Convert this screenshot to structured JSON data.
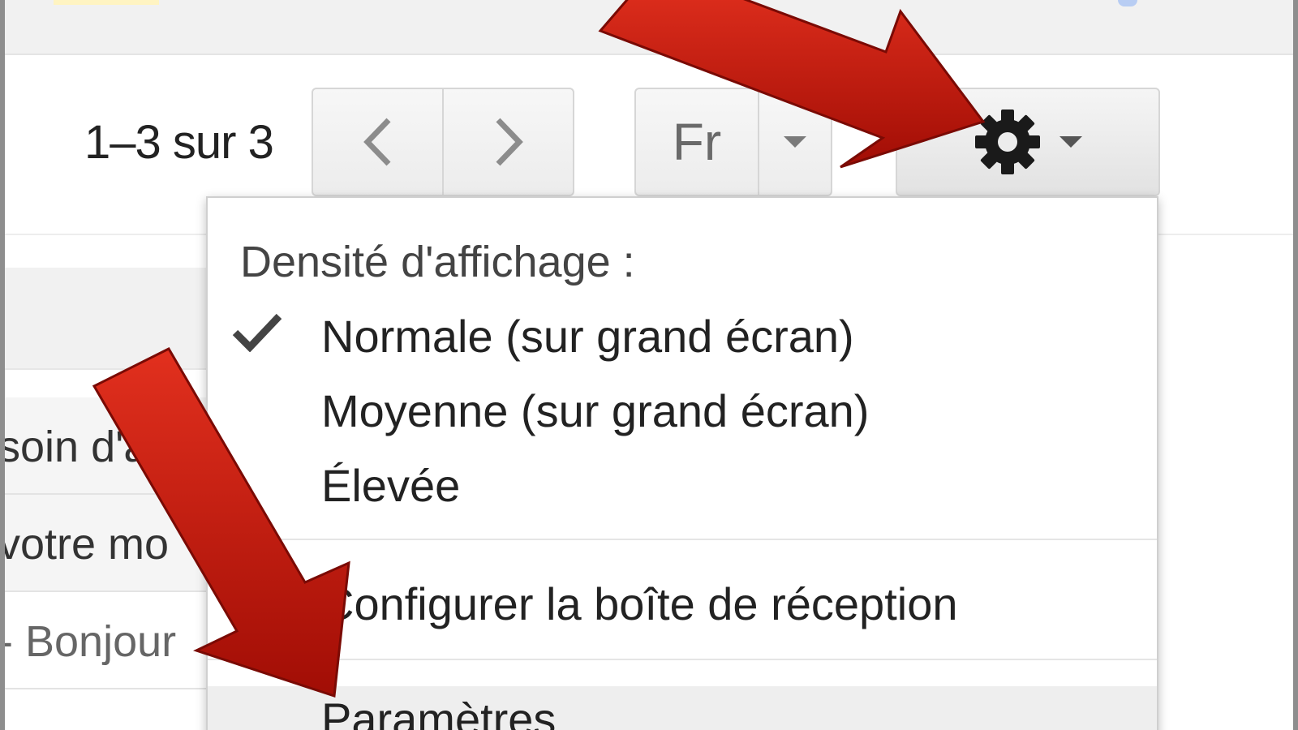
{
  "toolbar": {
    "counter": "1–3 sur 3",
    "language_label": "Fr"
  },
  "menu": {
    "header": "Densité d'affichage :",
    "density_options": [
      {
        "label": "Normale (sur grand écran)",
        "checked": true
      },
      {
        "label": "Moyenne (sur grand écran)",
        "checked": false
      },
      {
        "label": "Élevée",
        "checked": false
      }
    ],
    "configure_inbox": "Configurer la boîte de réception",
    "settings": "Paramètres"
  },
  "email_list": {
    "rows": [
      {
        "snippet": "soin d'a"
      },
      {
        "snippet": "votre mo"
      },
      {
        "snippet": "- Bonjour"
      }
    ]
  },
  "icons": {
    "prev": "chevron-left-icon",
    "next": "chevron-right-icon",
    "gear": "gear-icon",
    "check": "check-icon",
    "caret": "caret-down-icon"
  },
  "colors": {
    "annotation_arrow": "#c0180c",
    "menu_highlight": "#eeeeee"
  }
}
